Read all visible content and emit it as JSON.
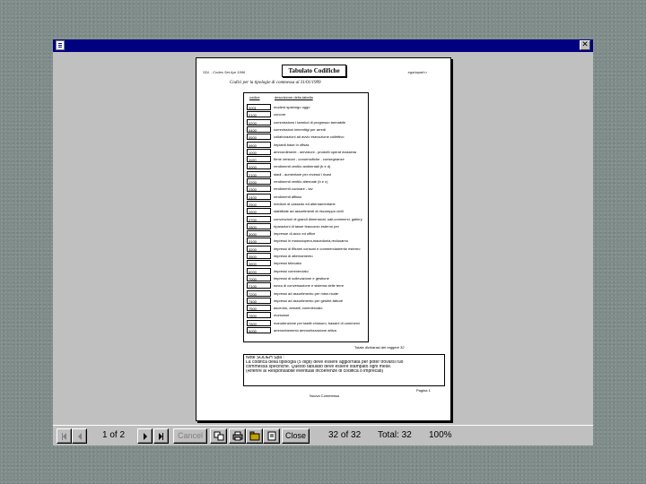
{
  "window": {
    "close_glyph": "✕"
  },
  "report": {
    "header_left": "SDL - Codes Set Apr 1996",
    "title": "Tabulato Codifiche",
    "header_right": "egahapath.r",
    "subtitle": "Codici per la tipologie di commessa al 31/01/1999",
    "col_code": "codice",
    "col_desc": "descrizione della tabella",
    "rows": [
      {
        "code": "0001",
        "desc": "modest spalongo oggo"
      },
      {
        "code": "0100",
        "desc": "curcore"
      },
      {
        "code": "0200",
        "desc": "commissions i tarmkol di progresso tarmabile"
      },
      {
        "code": "0400",
        "desc": "commissioni inimmitigi per arredi"
      },
      {
        "code": "0500",
        "desc": "collaborazioni ad avvio esecuzione collettivo"
      },
      {
        "code": "0600",
        "desc": "impianti base in offsas"
      },
      {
        "code": "1000",
        "desc": "ammordimenti - servizioni - prodotti operat massima"
      },
      {
        "code": "1100",
        "desc": "firme versioni - conormofiche - consegnanze"
      },
      {
        "code": "2000",
        "desc": "rendimenti ventilo ambientali (b e d)"
      },
      {
        "code": "2100",
        "desc": "stadi - aumentare per recessi i ricavi"
      },
      {
        "code": "2200",
        "desc": "rendimenti ventilo alternate (b e c)"
      },
      {
        "code": "2300",
        "desc": "rendimenti cucinare - lav"
      },
      {
        "code": "2400",
        "desc": "rendimenti affisso"
      },
      {
        "code": "2500",
        "desc": "medioni di cassedo ed alternamentarie"
      },
      {
        "code": "2600",
        "desc": "stabilitate ad assortimenti di riscomppo civili"
      },
      {
        "code": "2700",
        "desc": "convenzioni di grandi dimensioni, sall-commerci, gallery"
      },
      {
        "code": "2800",
        "desc": "riparazioni di tasse tiracconio esterno per"
      },
      {
        "code": "3000",
        "desc": "impresse di-acco ed uffice"
      },
      {
        "code": "3100",
        "desc": "impressi in manodopera,macedonia,reclusamo"
      },
      {
        "code": "3200",
        "desc": "impressi di filtrami consoni e commerciamento esterno"
      },
      {
        "code": "3500",
        "desc": "impressi di alternamento"
      },
      {
        "code": "3600",
        "desc": "impressi telecabo"
      },
      {
        "code": "6000",
        "desc": "impressi commercialo"
      },
      {
        "code": "7000",
        "desc": "impressi di sollevazione e gestione"
      },
      {
        "code": "7100",
        "desc": "sovra di conversazione e sistema delle terre"
      },
      {
        "code": "7200",
        "desc": "impressi ad assortimento per mise-ricate"
      },
      {
        "code": "7400",
        "desc": "impressi ad assortimento per gestire-fattore"
      },
      {
        "code": "7500",
        "desc": "ascendo, armatti, commercialo"
      },
      {
        "code": "7600",
        "desc": "morsosse"
      },
      {
        "code": "7800",
        "desc": "manutenzione per tastiti chiusuro, bassini di commerci"
      },
      {
        "code": "9000",
        "desc": "ammontamento ammortizzazione attiva"
      }
    ],
    "count_line": "Totale dichiarasi del reggere 32",
    "notes": [
      "Note SODEH Spa :",
      "La codifica della tipologia (5 digit) deve essere aggiornata per poter trovarsi ruo",
      "commessa specifiche. Questo tabulato deve essere stampato ogni mese.",
      "(Riferire al Responsabile eventuali incoerenze di codifica o imprecati)"
    ],
    "page_label": "Pagina 1",
    "footer": "Nuova Commessa"
  },
  "toolbar": {
    "page_of": "1 of 2",
    "cancel": "Cancel",
    "close": "Close",
    "record": "32 of 32",
    "total": "Total: 32",
    "zoom": "100%"
  }
}
